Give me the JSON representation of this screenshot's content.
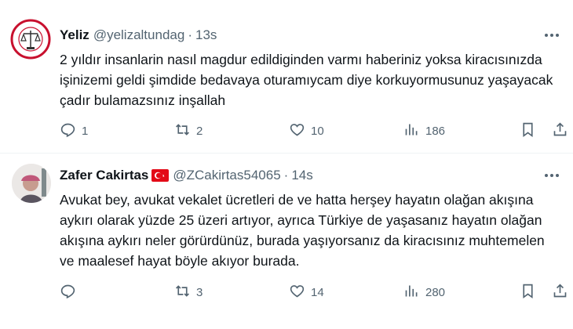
{
  "tweets": [
    {
      "author": {
        "name": "Yeliz",
        "handle": "@yelizaltundag"
      },
      "separator": "·",
      "time": "13s",
      "text": "2 yıldır insanlarin nasıl magdur edildiginden varmı haberiniz yoksa kiracısınızda işinizemi geldi şimdide bedavaya oturamıycam diye korkuyormusunuz yaşayacak çadır bulamazsınız inşallah",
      "stats": {
        "replies": "1",
        "reposts": "2",
        "likes": "10",
        "views": "186"
      }
    },
    {
      "author": {
        "name": "Zafer Cakirtas",
        "handle": "@ZCakirtas54065",
        "flag_icon": "turkey-flag-icon"
      },
      "separator": "·",
      "time": "14s",
      "text": "Avukat bey, avukat vekalet ücretleri de ve hatta herşey hayatın olağan akışına aykırı olarak yüzde 25 üzeri artıyor, ayrıca Türkiye de yaşasanız hayatın olağan akışına aykırı neler görürdünüz, burada yaşıyorsanız da kiracısınız muhtemelen ve maalesef hayat böyle akıyor burada.",
      "stats": {
        "replies": "",
        "reposts": "3",
        "likes": "14",
        "views": "280"
      }
    }
  ],
  "icons": [
    "reply-icon",
    "repost-icon",
    "like-icon",
    "views-icon",
    "bookmark-icon",
    "share-icon",
    "more-icon"
  ],
  "colors": {
    "text": "#0f1419",
    "secondary": "#536471",
    "divider": "#eff3f4",
    "flag_red": "#e30a17"
  }
}
